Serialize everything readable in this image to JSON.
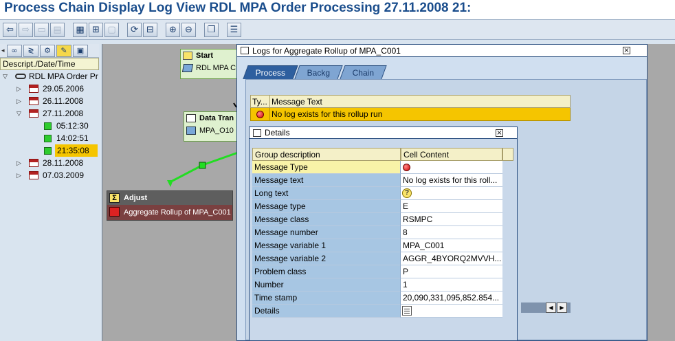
{
  "window_title": "Process Chain Display Log View RDL MPA Order Processing 27.11.2008 21:",
  "toolbar": {
    "icons": [
      "back-icon",
      "forward-icon",
      "display-icon",
      "change-icon",
      "structure-icon",
      "maintain-icon",
      "tools-icon",
      "refresh-icon",
      "planning-icon",
      "zoom-in-icon",
      "zoom-out-icon",
      "window-icon",
      "log-icon"
    ]
  },
  "left_panel": {
    "column_header": "Descript./Date/Time",
    "root_label": "RDL MPA Order Pr",
    "items": [
      {
        "label": "29.05.2006",
        "type": "date"
      },
      {
        "label": "26.11.2008",
        "type": "date"
      },
      {
        "label": "27.11.2008",
        "type": "date"
      },
      {
        "label": "05:12:30",
        "type": "run"
      },
      {
        "label": "14:02:51",
        "type": "run"
      },
      {
        "label": "21:35:08",
        "type": "run"
      },
      {
        "label": "28.11.2008",
        "type": "date"
      },
      {
        "label": "07.03.2009",
        "type": "date"
      }
    ]
  },
  "canvas": {
    "start_node": {
      "title": "Start",
      "sub": "RDL MPA C"
    },
    "data_node": {
      "title": "Data Tran",
      "sub": "MPA_O10"
    },
    "adjust_node": {
      "title": "Adjust",
      "sub": "Aggregate Rollup of MPA_C001"
    }
  },
  "logs_dialog": {
    "title": "Logs for Aggregate Rollup of MPA_C001",
    "tabs": [
      "Process",
      "Backg",
      "Chain"
    ],
    "table": {
      "col_type": "Ty...",
      "col_text": "Message Text",
      "rows": [
        {
          "text": "No log exists for this rollup run"
        }
      ]
    }
  },
  "details_dialog": {
    "title": "Details",
    "header": {
      "group": "Group description",
      "cell": "Cell Content"
    },
    "rows": [
      {
        "group": "Message Type",
        "cell": ""
      },
      {
        "group": "Message text",
        "cell": "No log exists for this roll..."
      },
      {
        "group": "Long text",
        "cell": ""
      },
      {
        "group": "Message type",
        "cell": "E"
      },
      {
        "group": "Message class",
        "cell": "RSMPC"
      },
      {
        "group": "Message number",
        "cell": "8"
      },
      {
        "group": "Message variable 1",
        "cell": "MPA_C001"
      },
      {
        "group": "Message variable 2",
        "cell": "AGGR_4BYORQ2MVVH..."
      },
      {
        "group": "Problem class",
        "cell": "P"
      },
      {
        "group": "Number",
        "cell": "1"
      },
      {
        "group": "Time stamp",
        "cell": "20,090,331,095,852.854..."
      },
      {
        "group": "Details",
        "cell": ""
      }
    ]
  }
}
